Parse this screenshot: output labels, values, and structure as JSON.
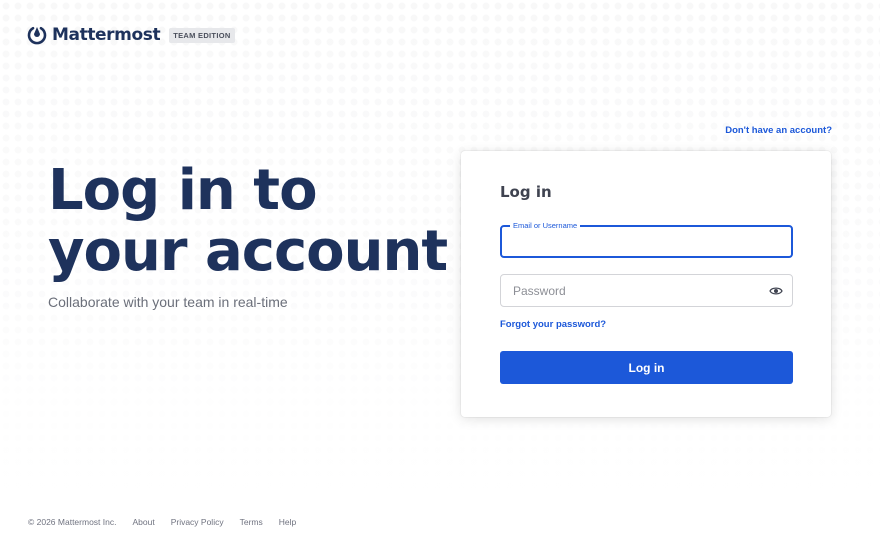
{
  "header": {
    "brand_name": "Mattermost",
    "edition": "TEAM EDITION",
    "logo_icon": "mattermost-logo-icon"
  },
  "signup": {
    "link_label": "Don't have an account?"
  },
  "hero": {
    "title": "Log in to your account",
    "subtitle": "Collaborate with your team in real-time"
  },
  "login_card": {
    "title": "Log in",
    "email_label": "Email or Username",
    "email_value": "",
    "password_placeholder": "Password",
    "show_password_icon": "eye-icon",
    "forgot_label": "Forgot your password?",
    "submit_label": "Log in"
  },
  "footer": {
    "copyright": "© 2026 Mattermost Inc.",
    "links": [
      "About",
      "Privacy Policy",
      "Terms",
      "Help"
    ]
  },
  "colors": {
    "primary": "#1c58d9",
    "brand_navy": "#1e325c",
    "text": "#3f4350"
  }
}
